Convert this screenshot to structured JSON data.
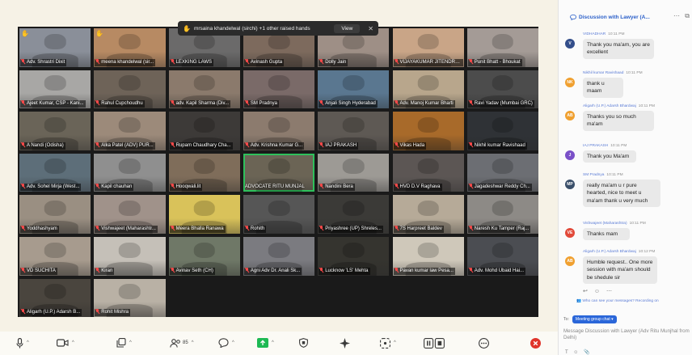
{
  "raised_hands": {
    "text": "mrsaina khandelwal (sirchi) +1 other raised hands",
    "view_label": "View"
  },
  "tiles": [
    {
      "name": "Adv. Shrastri Dixit",
      "color": "#8a8f99",
      "hand": true
    },
    {
      "name": "meena khandelwal (sir...",
      "color": "#b78a63",
      "hand": true
    },
    {
      "name": "LEXKING LAWS",
      "color": "#6b6a6a"
    },
    {
      "name": "Avinash Gupta",
      "color": "#7d6a5d"
    },
    {
      "name": "Dolly Jain",
      "color": "#9e8f86"
    },
    {
      "name": "VIJAYAKUMAR JITENDRA...",
      "color": "#c9a587"
    },
    {
      "name": "Punit Bhatt - Bhoukat",
      "color": "#a49b96"
    },
    {
      "name": "Ajeet Kumar, CSP - Kani...",
      "color": "#a8a7a5"
    },
    {
      "name": "Rahul Cupchoudhu",
      "color": "#6e6358"
    },
    {
      "name": "adv. Kapil Sharma (Div...",
      "color": "#8b7a6c"
    },
    {
      "name": "SM Pradnya",
      "color": "#7a6a68"
    },
    {
      "name": "Anjali Singh Hyderabad",
      "color": "#5a7790"
    },
    {
      "name": "Adv. Manoj Kumar Bharti",
      "color": "#b8a68c"
    },
    {
      "name": "Ravi Yadav (Mumbai GRC)",
      "color": "#4c4c4c"
    },
    {
      "name": "A Nandi (Odisha)",
      "color": "#6a6458"
    },
    {
      "name": "Alka Patel (ADV) PUR...",
      "color": "#9c8a7a"
    },
    {
      "name": "Rupam Chaudhary Cha...",
      "color": "#3d3a38"
    },
    {
      "name": "Adv. Krishna Kumar G...",
      "color": "#8c7b6e"
    },
    {
      "name": "IAJ PRAKASH",
      "color": "#5e5954"
    },
    {
      "name": "Vikas Hada",
      "color": "#a86a2a"
    },
    {
      "name": "Nikhil kumar Ravishaad",
      "color": "#2f3236"
    },
    {
      "name": "Adv. Sohel Mirja (West...",
      "color": "#5d6e79"
    },
    {
      "name": "Kapil chauhan",
      "color": "#8f8f8f"
    },
    {
      "name": "Hooqwali.lit",
      "color": "#7f6d5a"
    },
    {
      "name": "ADVOCATE RITU MUNJAL",
      "color": "#6b6455",
      "active": true
    },
    {
      "name": "Nandini Bera",
      "color": "#9d9a95"
    },
    {
      "name": "HVD D.V Raghava",
      "color": "#5c5654"
    },
    {
      "name": "Jagadeshwar Reddy Ch...",
      "color": "#6c6e73"
    },
    {
      "name": "Yoddhashyam",
      "color": "#9a8f82"
    },
    {
      "name": "Vishwajeet (Maharashtr...",
      "color": "#a0928a"
    },
    {
      "name": "Meera Bhalla Ranawa",
      "color": "#d9c25a"
    },
    {
      "name": "Rohith",
      "color": "#565656"
    },
    {
      "name": "Priyashree (UP) Shreles...",
      "color": "#3b3a37"
    },
    {
      "name": "7S Harpreet Baldev",
      "color": "#b6aa98"
    },
    {
      "name": "Naresh Ku Tamper (Raj...",
      "color": "#8d8a86"
    },
    {
      "name": "VD SUCHITA",
      "color": "#a79b8e"
    },
    {
      "name": "Kiran",
      "color": "#c5c0b8"
    },
    {
      "name": "Avinav Seth (CH)",
      "color": "#6f7867"
    },
    {
      "name": "Agni Adv Dr. Anali Sk...",
      "color": "#7b7b80"
    },
    {
      "name": "Lucknow 'LS' Mehta",
      "color": "#35342f"
    },
    {
      "name": "Pavan kumar law Pesa...",
      "color": "#cfc8ba"
    },
    {
      "name": "Adv. Mohd Ubaid Hai...",
      "color": "#4b4d52"
    },
    {
      "name": "Aligarh (U.P.) Adarsh B...",
      "color": "#4a453e"
    },
    {
      "name": "Rohit Mishra",
      "color": "#b9b1a5"
    }
  ],
  "toolbar": {
    "items": [
      {
        "name": "audio",
        "has_caret": true
      },
      {
        "name": "video",
        "has_caret": true
      },
      {
        "name": "security",
        "has_caret": true
      },
      {
        "name": "participants",
        "count": "85",
        "has_caret": true
      },
      {
        "name": "chat",
        "has_caret": true
      },
      {
        "name": "share",
        "has_caret": true
      },
      {
        "name": "shield"
      },
      {
        "name": "ai-companion"
      },
      {
        "name": "apps",
        "has_caret": true
      },
      {
        "name": "record"
      },
      {
        "name": "reactions"
      },
      {
        "name": "end"
      }
    ]
  },
  "chat": {
    "title": "Discussion with Lawyer (A...",
    "messages": [
      {
        "sender": "VIDHADHAR",
        "time": "10:11 PM",
        "initials": "V",
        "avatar_color": "#334e8a",
        "text": "Thank you ma'am, you are excellent"
      },
      {
        "sender": "Nikhil kumar Ravishaad",
        "time": "10:11 PM",
        "initials": "NK",
        "avatar_color": "#f0a030",
        "text": "thank u maam"
      },
      {
        "sender": "Aligarh (U.P.) Adarsh Bhardwaj",
        "time": "10:11 PM",
        "initials": "AB",
        "avatar_color": "#f0a030",
        "text": "Thanks you so much ma'am"
      },
      {
        "sender": "IAJ PRAKASH",
        "time": "10:11 PM",
        "initials": "J",
        "avatar_color": "#7a50c8",
        "text": "Thank you Ma'am"
      },
      {
        "sender": "SM Pradnya",
        "time": "10:11 PM",
        "initials": "MP",
        "avatar_color": "#3a4f6a",
        "text": "really ma'am u r pure hearted, nice to meet u ma'am thank u very much"
      },
      {
        "sender": "Vishwajeet (Maharashtra)",
        "time": "10:11 PM",
        "initials": "VE",
        "avatar_color": "#e24a3a",
        "text": "Thanks mam"
      },
      {
        "sender": "Aligarh (U.P.) Adarsh Bhardwaj",
        "time": "10:12 PM",
        "initials": "AB",
        "avatar_color": "#f0a030",
        "text": "Humble request.. One more session with ma'am should be shedule sir"
      }
    ],
    "visibility_text": "Who can see your messages? Recording on",
    "to_label": "To:",
    "to_chip": "Meeting group chat",
    "input_placeholder": "Message Discussion with Lawyer (Adv Ritu Munjhal from Delhi)"
  }
}
